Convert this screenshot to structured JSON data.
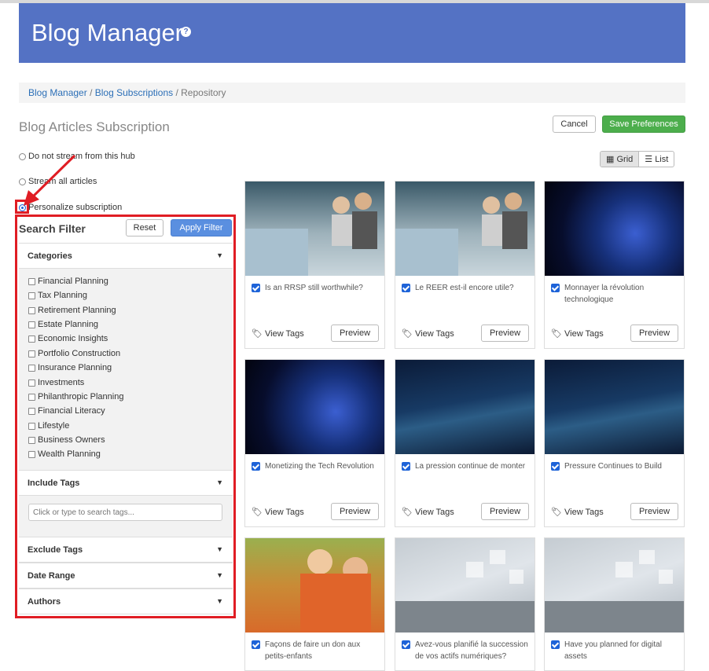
{
  "header": {
    "title": "Blog Manager",
    "help_icon": "help-circle-icon"
  },
  "breadcrumb": {
    "items": [
      "Blog Manager",
      "Blog Subscriptions",
      "Repository"
    ]
  },
  "page": {
    "title": "Blog Articles Subscription",
    "cancel_label": "Cancel",
    "save_label": "Save Preferences"
  },
  "options": [
    {
      "label": "Do not stream from this hub",
      "checked": false
    },
    {
      "label": "Stream all articles",
      "checked": false
    },
    {
      "label": "Personalize subscription",
      "checked": true
    }
  ],
  "filter": {
    "title": "Search Filter",
    "reset_label": "Reset",
    "apply_label": "Apply Filter",
    "categories_label": "Categories",
    "categories": [
      "Financial Planning",
      "Tax Planning",
      "Retirement Planning",
      "Estate Planning",
      "Economic Insights",
      "Portfolio Construction",
      "Insurance Planning",
      "Investments",
      "Philanthropic Planning",
      "Financial Literacy",
      "Lifestyle",
      "Business Owners",
      "Wealth Planning"
    ],
    "include_tags_label": "Include Tags",
    "tags_placeholder": "Click or type to search tags...",
    "exclude_tags_label": "Exclude Tags",
    "date_range_label": "Date Range",
    "authors_label": "Authors"
  },
  "view": {
    "grid_label": "Grid",
    "list_label": "List",
    "active": "Grid"
  },
  "cards": [
    {
      "title": "Is an RRSP still worthwhile?",
      "image": "office-meeting",
      "checked": true,
      "view_tags": "View Tags",
      "preview": "Preview"
    },
    {
      "title": "Le REER est-il encore utile?",
      "image": "office-meeting",
      "checked": true,
      "view_tags": "View Tags",
      "preview": "Preview"
    },
    {
      "title": "Monnayer la révolution technologique",
      "image": "digital-globe",
      "checked": true,
      "view_tags": "View Tags",
      "preview": "Preview"
    },
    {
      "title": "Monetizing the Tech Revolution",
      "image": "digital-globe",
      "checked": true,
      "view_tags": "View Tags",
      "preview": "Preview"
    },
    {
      "title": "La pression continue de monter",
      "image": "particle-wave",
      "checked": true,
      "view_tags": "View Tags",
      "preview": "Preview"
    },
    {
      "title": "Pressure Continues to Build",
      "image": "particle-wave",
      "checked": true,
      "view_tags": "View Tags",
      "preview": "Preview"
    },
    {
      "title": "Façons de faire un don aux petits-enfants",
      "image": "grandparent-child",
      "checked": true
    },
    {
      "title": "Avez-vous planifié la succession de vos actifs numériques?",
      "image": "typing-laptop",
      "checked": true
    },
    {
      "title": "Have you planned for digital assets",
      "image": "typing-laptop",
      "checked": true
    }
  ],
  "colors": {
    "header": "#5472c4",
    "accent_blue": "#1e63d8",
    "save_green": "#4cae4c",
    "highlight_red": "#e01d24"
  }
}
